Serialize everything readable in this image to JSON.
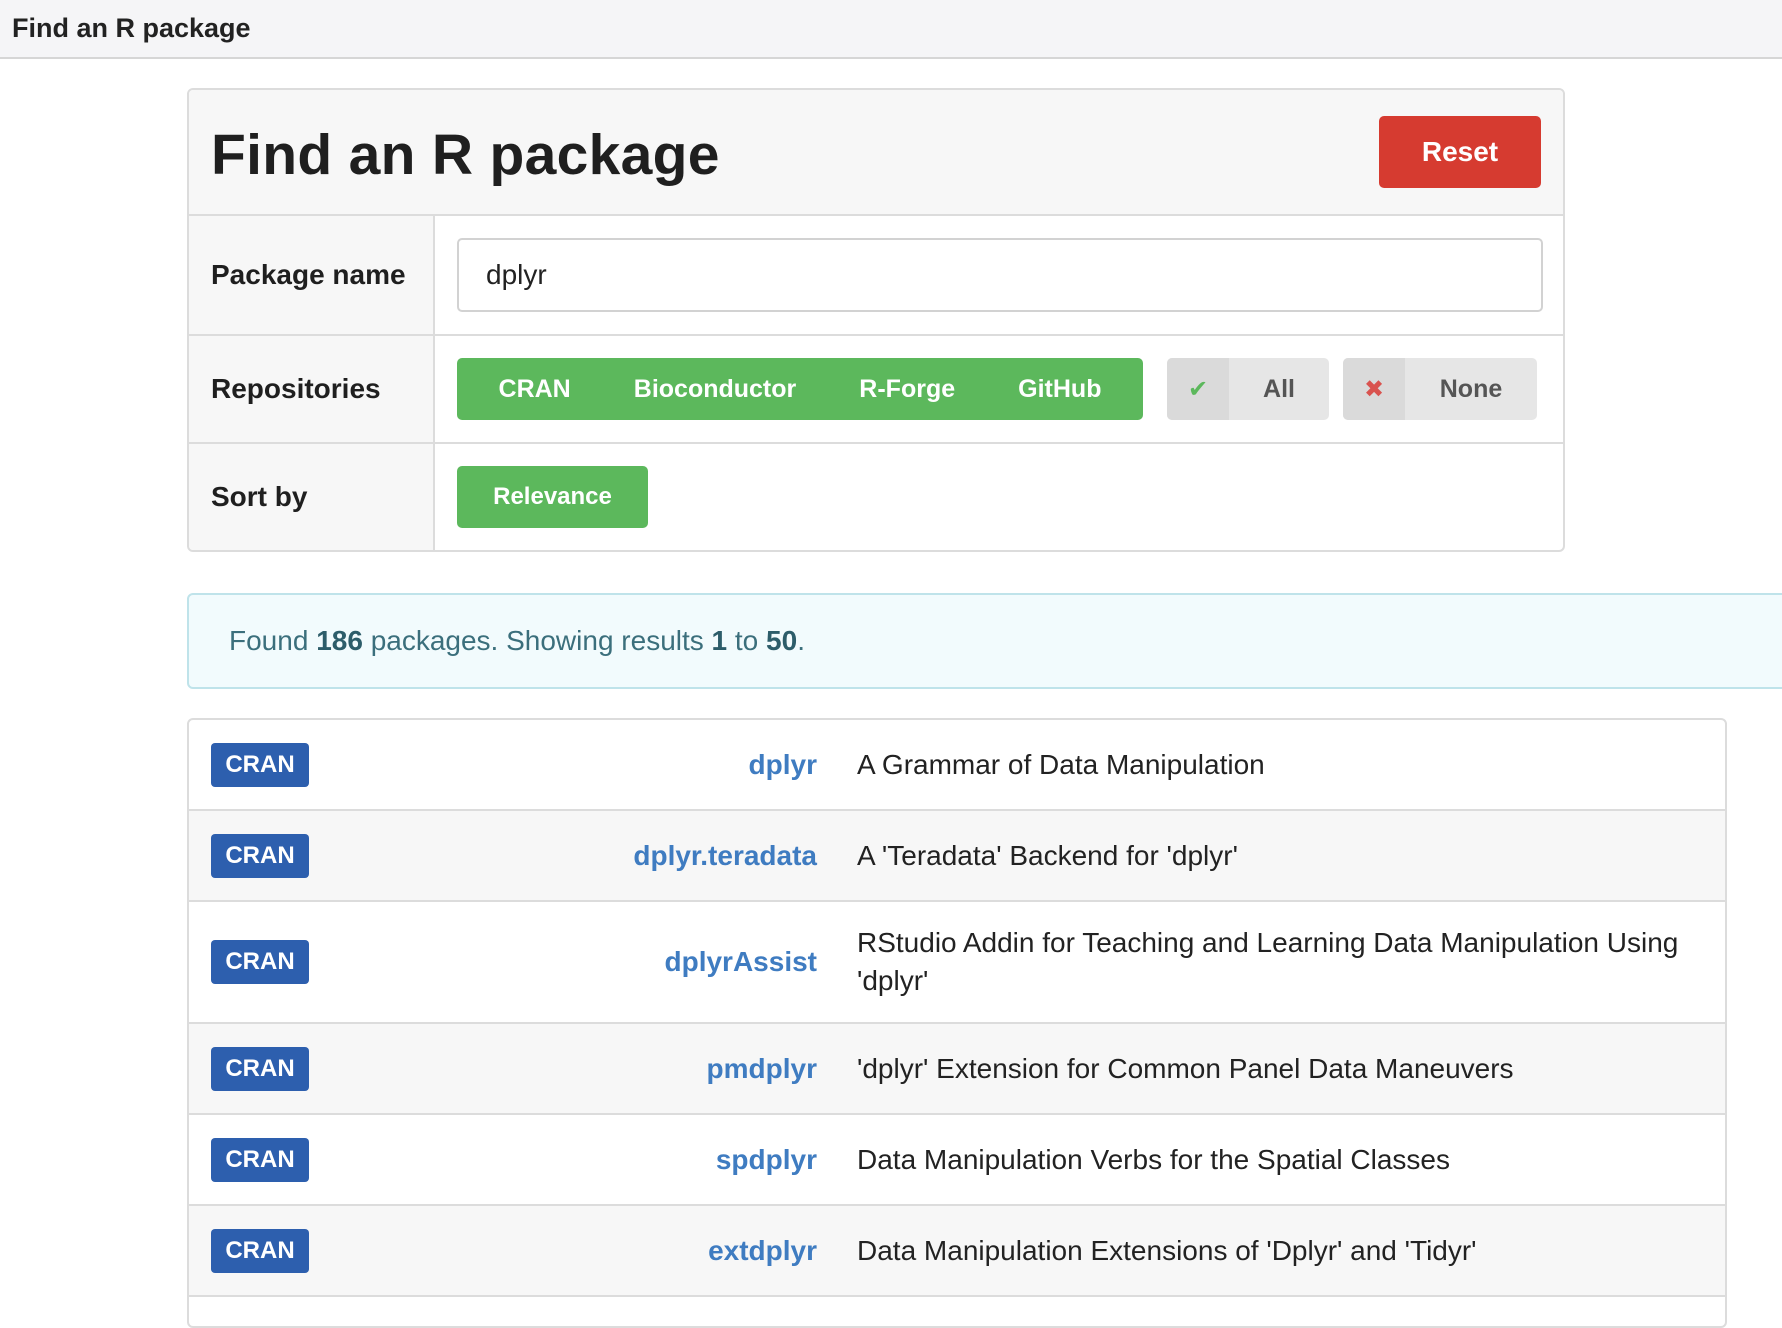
{
  "window": {
    "title": "Find an R package"
  },
  "panel": {
    "title": "Find an R package",
    "reset_label": "Reset",
    "package_name_label": "Package name",
    "package_name_value": "dplyr",
    "repositories_label": "Repositories",
    "repositories": [
      "CRAN",
      "Bioconductor",
      "R-Forge",
      "GitHub"
    ],
    "all_label": "All",
    "none_label": "None",
    "sort_label": "Sort by",
    "sort_value": "Relevance"
  },
  "summary": {
    "prefix": "Found",
    "total": "186",
    "middle": "packages. Showing results",
    "from": "1",
    "to_word": "to",
    "to": "50",
    "suffix": "."
  },
  "results": [
    {
      "repo": "CRAN",
      "name": "dplyr",
      "description": "A Grammar of Data Manipulation"
    },
    {
      "repo": "CRAN",
      "name": "dplyr.teradata",
      "description": "A 'Teradata' Backend for 'dplyr'"
    },
    {
      "repo": "CRAN",
      "name": "dplyrAssist",
      "description": "RStudio Addin for Teaching and Learning Data Manipulation Using 'dplyr'"
    },
    {
      "repo": "CRAN",
      "name": "pmdplyr",
      "description": "'dplyr' Extension for Common Panel Data Maneuvers"
    },
    {
      "repo": "CRAN",
      "name": "spdplyr",
      "description": "Data Manipulation Verbs for the Spatial Classes"
    },
    {
      "repo": "CRAN",
      "name": "extdplyr",
      "description": "Data Manipulation Extensions of 'Dplyr' and 'Tidyr'"
    }
  ],
  "colors": {
    "reset": "#d63b30",
    "success": "#5cb85c",
    "badge": "#2d5fae",
    "link": "#3f7cc1",
    "alert_bg": "#f2fbfd"
  },
  "icons": {
    "all": "check-icon",
    "none": "cross-icon"
  }
}
